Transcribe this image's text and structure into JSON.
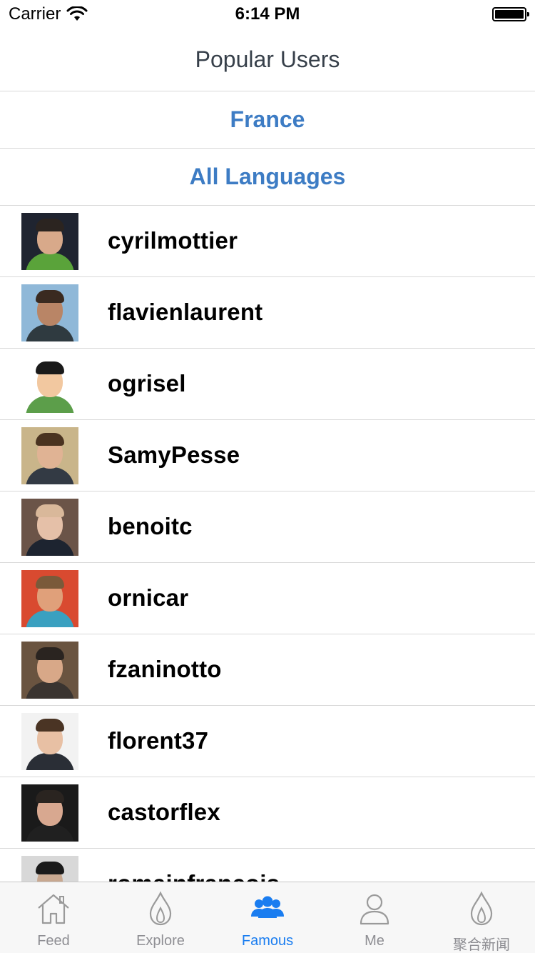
{
  "status_bar": {
    "carrier": "Carrier",
    "time": "6:14 PM"
  },
  "nav": {
    "title": "Popular Users"
  },
  "filters": {
    "country": "France",
    "language": "All Languages"
  },
  "users": [
    {
      "name": "cyrilmottier",
      "avatar": {
        "bg": "#1f2430",
        "skin": "#d8a98a",
        "hair": "#2b2420",
        "shirt": "#5aa33a"
      }
    },
    {
      "name": "flavienlaurent",
      "avatar": {
        "bg": "#8fb8d8",
        "skin": "#b98566",
        "hair": "#3a2a20",
        "shirt": "#2f3a40"
      }
    },
    {
      "name": "ogrisel",
      "avatar": {
        "bg": "#ffffff",
        "skin": "#f2c8a0",
        "hair": "#1a1a1a",
        "shirt": "#5c9e4a"
      }
    },
    {
      "name": "SamyPesse",
      "avatar": {
        "bg": "#c9b58a",
        "skin": "#e0b394",
        "hair": "#4a3320",
        "shirt": "#333a44"
      }
    },
    {
      "name": "benoitc",
      "avatar": {
        "bg": "#6b5448",
        "skin": "#e5c0a8",
        "hair": "#d9b89a",
        "shirt": "#1d2430"
      }
    },
    {
      "name": "ornicar",
      "avatar": {
        "bg": "#d94a30",
        "skin": "#e0a07a",
        "hair": "#7a5a3a",
        "shirt": "#3aa0c0"
      }
    },
    {
      "name": "fzaninotto",
      "avatar": {
        "bg": "#6a5440",
        "skin": "#d8a888",
        "hair": "#2a2420",
        "shirt": "#3a3430"
      }
    },
    {
      "name": "florent37",
      "avatar": {
        "bg": "#f2f2f2",
        "skin": "#e8c0a4",
        "hair": "#4a3424",
        "shirt": "#2a2e36"
      }
    },
    {
      "name": "castorflex",
      "avatar": {
        "bg": "#1a1a1a",
        "skin": "#d8a890",
        "hair": "#2a2420",
        "shirt": "#202020"
      }
    },
    {
      "name": "romainfrancois",
      "avatar": {
        "bg": "#d8d8d8",
        "skin": "#c8a890",
        "hair": "#1a1a1a",
        "shirt": "#3a3a3a"
      }
    }
  ],
  "tabs": [
    {
      "label": "Feed",
      "icon": "home-icon",
      "active": false
    },
    {
      "label": "Explore",
      "icon": "flame-icon",
      "active": false
    },
    {
      "label": "Famous",
      "icon": "group-icon",
      "active": true
    },
    {
      "label": "Me",
      "icon": "person-icon",
      "active": false
    },
    {
      "label": "聚合新闻",
      "icon": "flame-icon",
      "active": false
    }
  ],
  "colors": {
    "accent": "#3d7cc4",
    "tab_active": "#1a7df0",
    "tab_inactive": "#8e8e93"
  }
}
